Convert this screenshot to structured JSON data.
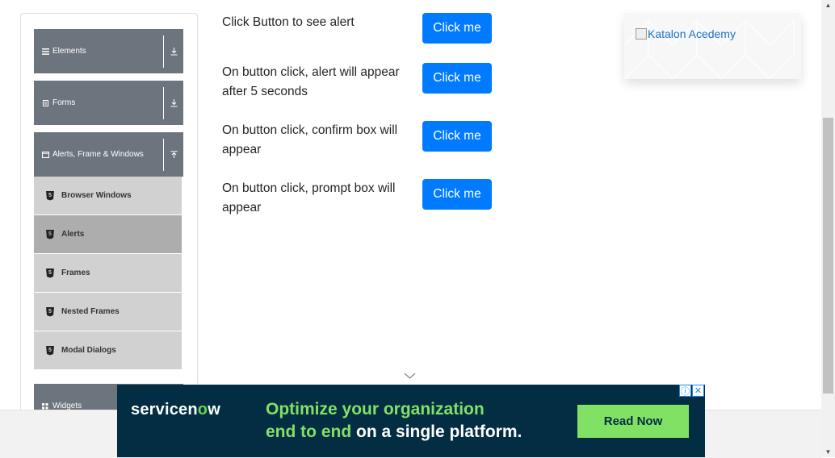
{
  "sidebar": {
    "groups": [
      {
        "label": "Elements",
        "icon": "list-icon"
      },
      {
        "label": "Forms",
        "icon": "form-icon"
      },
      {
        "label": "Alerts, Frame & Windows",
        "icon": "window-icon"
      },
      {
        "label": "Widgets",
        "icon": "grid-icon"
      }
    ],
    "items": [
      {
        "label": "Browser Windows",
        "active": false
      },
      {
        "label": "Alerts",
        "active": true
      },
      {
        "label": "Frames",
        "active": false
      },
      {
        "label": "Nested Frames",
        "active": false
      },
      {
        "label": "Modal Dialogs",
        "active": false
      }
    ]
  },
  "main": {
    "rows": [
      {
        "text": "Click Button to see alert",
        "button": "Click me"
      },
      {
        "text": "On button click, alert will appear after 5 seconds",
        "button": "Click me"
      },
      {
        "text": "On button click, confirm box will appear",
        "button": "Click me"
      },
      {
        "text": "On button click, prompt box will appear",
        "button": "Click me"
      }
    ]
  },
  "side_ad": {
    "alt_text": "Katalon Acedemy"
  },
  "banner_ad": {
    "logo_text": "servicen",
    "logo_now": "w",
    "headline_line1": "Optimize your organization",
    "headline_line2_green": "end to end",
    "headline_line2_white": " on a single platform.",
    "cta": "Read Now",
    "info_glyph": "ⓘ",
    "close_glyph": "✕"
  },
  "colors": {
    "primary": "#007bff",
    "sidebar_header": "#6c757d",
    "sidebar_item": "#d1d1d1",
    "banner_bg": "#032d42",
    "banner_green": "#81e165"
  }
}
